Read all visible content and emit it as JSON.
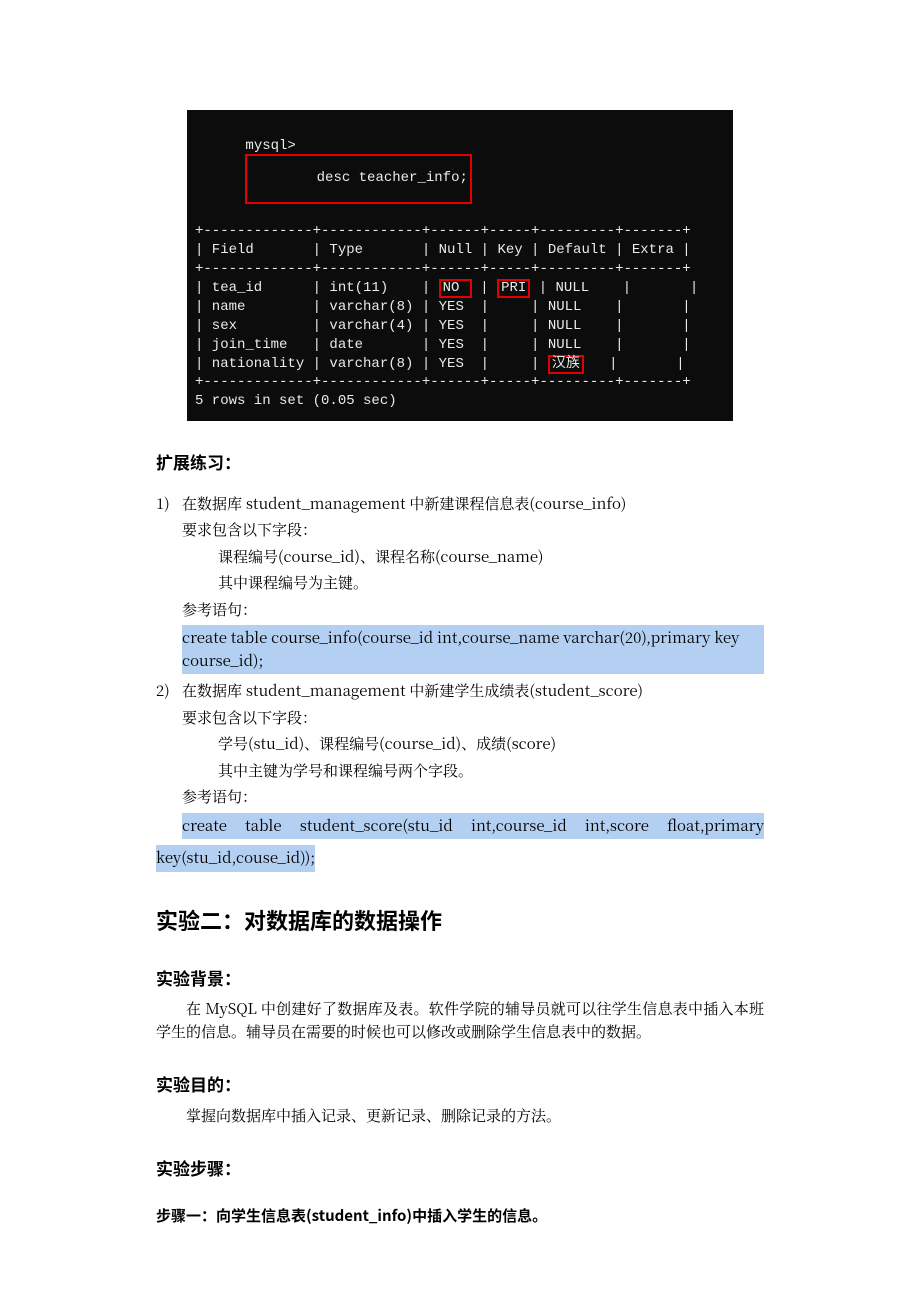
{
  "terminal": {
    "prompt": "mysql>",
    "command": "desc teacher_info;",
    "headers": [
      "Field",
      "Type",
      "Null",
      "Key",
      "Default",
      "Extra"
    ],
    "rows": [
      {
        "field": "tea_id",
        "type": "int(11)",
        "null": "NO",
        "key": "PRI",
        "default": "NULL",
        "extra": ""
      },
      {
        "field": "name",
        "type": "varchar(8)",
        "null": "YES",
        "key": "",
        "default": "NULL",
        "extra": ""
      },
      {
        "field": "sex",
        "type": "varchar(4)",
        "null": "YES",
        "key": "",
        "default": "NULL",
        "extra": ""
      },
      {
        "field": "join_time",
        "type": "date",
        "null": "YES",
        "key": "",
        "default": "NULL",
        "extra": ""
      },
      {
        "field": "nationality",
        "type": "varchar(8)",
        "null": "YES",
        "key": "",
        "default": "汉族",
        "extra": ""
      }
    ],
    "footer": "5 rows in set (0.05 sec)"
  },
  "ext_heading": "扩展练习：",
  "exercise1": {
    "num": "1)",
    "title": "在数据库 student_management 中新建课程信息表(course_info)",
    "req_line": "要求包含以下字段：",
    "fields_line": "课程编号(course_id)、课程名称(course_name)",
    "pk_line": "其中课程编号为主键。",
    "ref_line": "参考语句：",
    "sql": "create table course_info(course_id int,course_name varchar(20),primary key course_id);"
  },
  "exercise2": {
    "num": "2)",
    "title": "在数据库 student_management 中新建学生成绩表(student_score)",
    "req_line": "要求包含以下字段：",
    "fields_line": "学号(stu_id)、课程编号(course_id)、成绩(score)",
    "pk_line": "其中主键为学号和课程编号两个字段。",
    "ref_line": "参考语句：",
    "sql_tokens": [
      "create",
      "table",
      "student_score(stu_id",
      "int,course_id",
      "int,score",
      "float,primary"
    ],
    "sql_line2": "key(stu_id,couse_id));"
  },
  "exp2_heading": "实验二：对数据库的数据操作",
  "bg_heading": "实验背景：",
  "bg_text": "在 MySQL 中创建好了数据库及表。软件学院的辅导员就可以往学生信息表中插入本班学生的信息。辅导员在需要的时候也可以修改或删除学生信息表中的数据。",
  "goal_heading": "实验目的：",
  "goal_text": "掌握向数据库中插入记录、更新记录、删除记录的方法。",
  "steps_heading": "实验步骤：",
  "step1_line": "步骤一：向学生信息表(student_info)中插入学生的信息。"
}
